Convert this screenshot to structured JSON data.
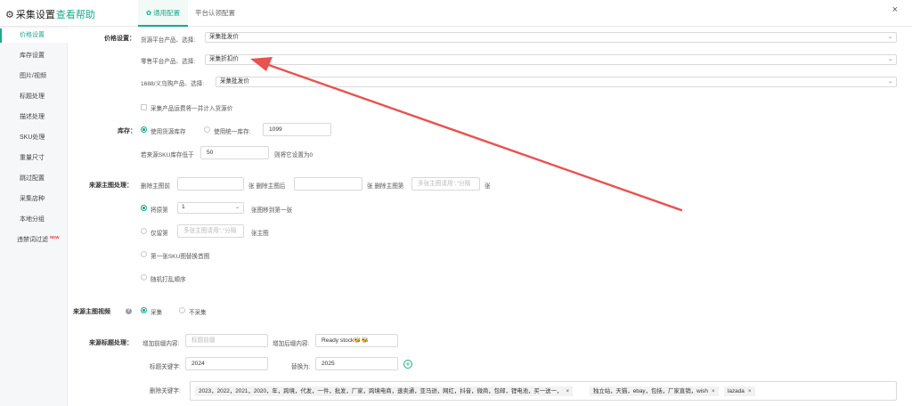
{
  "header": {
    "title": "采集设置",
    "help_link": "查看帮助",
    "tabs": [
      {
        "label": "通用配置",
        "active": true,
        "icon": "gear-icon"
      },
      {
        "label": "平台认领配置",
        "active": false
      }
    ],
    "close_icon": "close-icon"
  },
  "sidebar": {
    "items": [
      {
        "label": "价格设置",
        "active": true
      },
      {
        "label": "库存设置"
      },
      {
        "label": "图片/视频"
      },
      {
        "label": "标题处理"
      },
      {
        "label": "描述处理"
      },
      {
        "label": "SKU处理"
      },
      {
        "label": "重量尺寸"
      },
      {
        "label": "跳过配置"
      },
      {
        "label": "采集店种"
      },
      {
        "label": "本地分组"
      },
      {
        "label": "违禁词过滤",
        "badge": "NEW"
      }
    ]
  },
  "price": {
    "label": "价格设置：",
    "rows": [
      {
        "label": "货源平台产品、选择:",
        "value": "采集批发价"
      },
      {
        "label": "零售平台产品、选择:",
        "value": "采集折扣价"
      },
      {
        "label": "1688/义乌购产品、选择:",
        "value": "采集批发价"
      }
    ],
    "shipping_checkbox": {
      "label": "采集产品运费将一并计入货源价",
      "checked": false
    }
  },
  "stock": {
    "label": "库存：",
    "opt_source": {
      "label": "使用货源库存",
      "selected": true
    },
    "opt_unified": {
      "label": "使用统一库存:",
      "selected": false
    },
    "unified_value": "1099",
    "low_prefix": "若来源SKU库存低于",
    "low_value": "50",
    "low_suffix": "则将它设置为0"
  },
  "main_image": {
    "label": "来源主图处理：",
    "del_front_label": "删除主图前",
    "del_front_value": "",
    "unit1": "张 删除主图后",
    "del_back_value": "",
    "unit2": "张 删除主图第",
    "del_nth_placeholder": "多张主图请用\",\"分隔",
    "unit3": "张",
    "opt_move": {
      "label": "将原第",
      "selected": true,
      "value": "1",
      "suffix": "张图移到第一张"
    },
    "opt_keep": {
      "label": "仅留第",
      "selected": false,
      "placeholder": "多张主图请用\",\"分隔",
      "suffix": "张主图"
    },
    "opt_sku_first": {
      "label": "第一张SKU图替换首图",
      "selected": false
    },
    "opt_shuffle": {
      "label": "随机打乱顺序",
      "selected": false
    }
  },
  "video": {
    "label": "来源主图视频",
    "help_icon": "question-icon",
    "opt_collect": {
      "label": "采集",
      "selected": true
    },
    "opt_skip": {
      "label": "不采集",
      "selected": false
    }
  },
  "title_proc": {
    "label": "来源标题处理：",
    "prefix_label": "增加前缀内容:",
    "prefix_placeholder": "标题前缀",
    "suffix_label": "增加后缀内容:",
    "suffix_value": "Ready stock🐝🐝",
    "keyword_label": "标题关键字:",
    "keyword_value": "2024",
    "replace_label": "替换为:",
    "replace_value": "2025",
    "add_icon": "plus-circle-icon",
    "delete_label": "删除关键字:",
    "delete_tags": [
      "2023，2022，2021，2020，年，跨境，代发，一件，批发，厂家，跨境电商，速卖通，亚马逊，网红，抖音，微商，包邮，锂电池，买一送一，",
      "独立站，天猫，ebay，包括，厂家直销，wish",
      "lazada"
    ]
  },
  "colors": {
    "accent": "#1aaa8a",
    "arrow": "#e8524f",
    "badge": "#e84040"
  }
}
